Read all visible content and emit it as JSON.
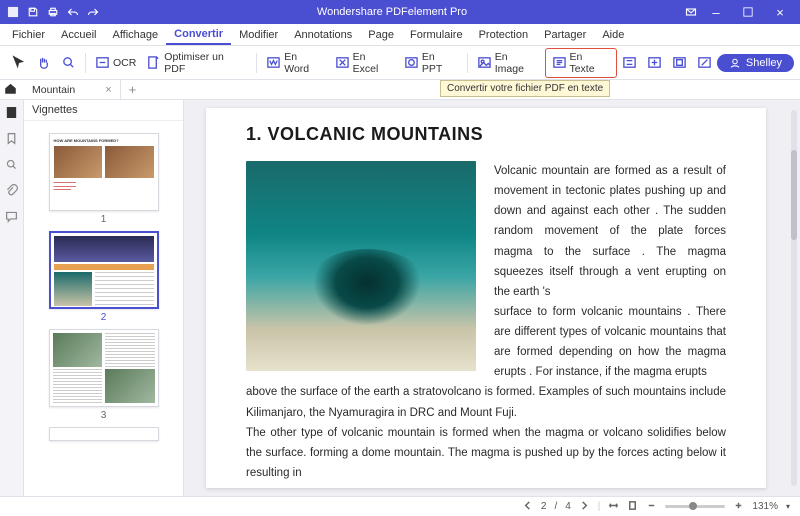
{
  "titlebar": {
    "app_title": "Wondershare PDFelement Pro"
  },
  "menu": {
    "items": [
      "Fichier",
      "Accueil",
      "Affichage",
      "Convertir",
      "Modifier",
      "Annotations",
      "Page",
      "Formulaire",
      "Protection",
      "Partager",
      "Aide"
    ],
    "active_index": 3
  },
  "toolbar": {
    "ocr": "OCR",
    "optimize": "Optimiser un PDF",
    "word": "En Word",
    "excel": "En Excel",
    "ppt": "En PPT",
    "image": "En Image",
    "text": "En Texte",
    "tooltip": "Convertir votre fichier PDF en texte",
    "user": "Shelley"
  },
  "tabs": {
    "doc": "Mountain"
  },
  "sidebar": {
    "header": "Vignettes"
  },
  "thumbs": {
    "p1": "1",
    "p2": "2",
    "p3": "3"
  },
  "doc": {
    "heading": "1. VOLCANIC MOUNTAINS",
    "para1": "Volcanic mountain are formed as a result of movement in tectonic plates pushing up and down and against each other . The sudden random movement of the plate forces magma to the surface . The magma squeezes itself through a vent erupting on the earth 's",
    "para2": "surface to form volcanic mountains . There are different types of volcanic mountains that are formed depending on how the magma erupts . For instance, if the magma erupts",
    "para3": "above the surface of the earth a stratovolcano is formed. Examples of such mountains include Kilimanjaro, the Nyamuragira in DRC and Mount Fuji.",
    "para4": "The other type of volcanic mountain is formed when the magma or volcano solidifies below the surface. forming a dome mountain. The magma is pushed up by the forces acting below it resulting in"
  },
  "status": {
    "page_current": "2",
    "page_sep": "/",
    "page_total": "4",
    "zoom": "131%"
  }
}
